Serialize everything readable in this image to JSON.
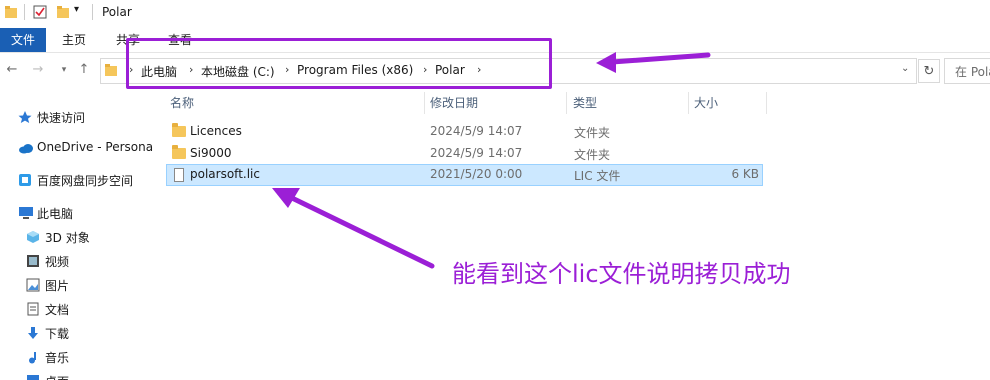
{
  "window": {
    "title": "Polar"
  },
  "ribbon": {
    "tabs": [
      "文件",
      "主页",
      "共享",
      "查看"
    ]
  },
  "address": {
    "crumbs": [
      "此电脑",
      "本地磁盘 (C:)",
      "Program Files (x86)",
      "Polar"
    ],
    "search_placeholder": "在 Polar"
  },
  "sidebar": {
    "items": [
      {
        "label": "快速访问",
        "icon": "star-icon"
      },
      {
        "label": "OneDrive - Persona",
        "icon": "cloud-icon"
      },
      {
        "label": "百度网盘同步空间",
        "icon": "baidu-sync-icon"
      },
      {
        "label": "此电脑",
        "icon": "computer-icon"
      },
      {
        "label": "3D 对象",
        "icon": "cube-icon"
      },
      {
        "label": "视频",
        "icon": "video-icon"
      },
      {
        "label": "图片",
        "icon": "picture-icon"
      },
      {
        "label": "文档",
        "icon": "document-icon"
      },
      {
        "label": "下载",
        "icon": "download-icon"
      },
      {
        "label": "音乐",
        "icon": "music-icon"
      },
      {
        "label": "桌面",
        "icon": "desktop-icon"
      }
    ]
  },
  "columns": {
    "name": "名称",
    "modified": "修改日期",
    "type": "类型",
    "size": "大小"
  },
  "files": [
    {
      "name": "Licences",
      "modified": "2024/5/9 14:07",
      "type": "文件夹",
      "size": ""
    },
    {
      "name": "Si9000",
      "modified": "2024/5/9 14:07",
      "type": "文件夹",
      "size": ""
    },
    {
      "name": "polarsoft.lic",
      "modified": "2021/5/20 0:00",
      "type": "LIC 文件",
      "size": "6 KB"
    }
  ],
  "annotation": {
    "text": "能看到这个lic文件说明拷贝成功",
    "color": "#9b1fd6"
  }
}
